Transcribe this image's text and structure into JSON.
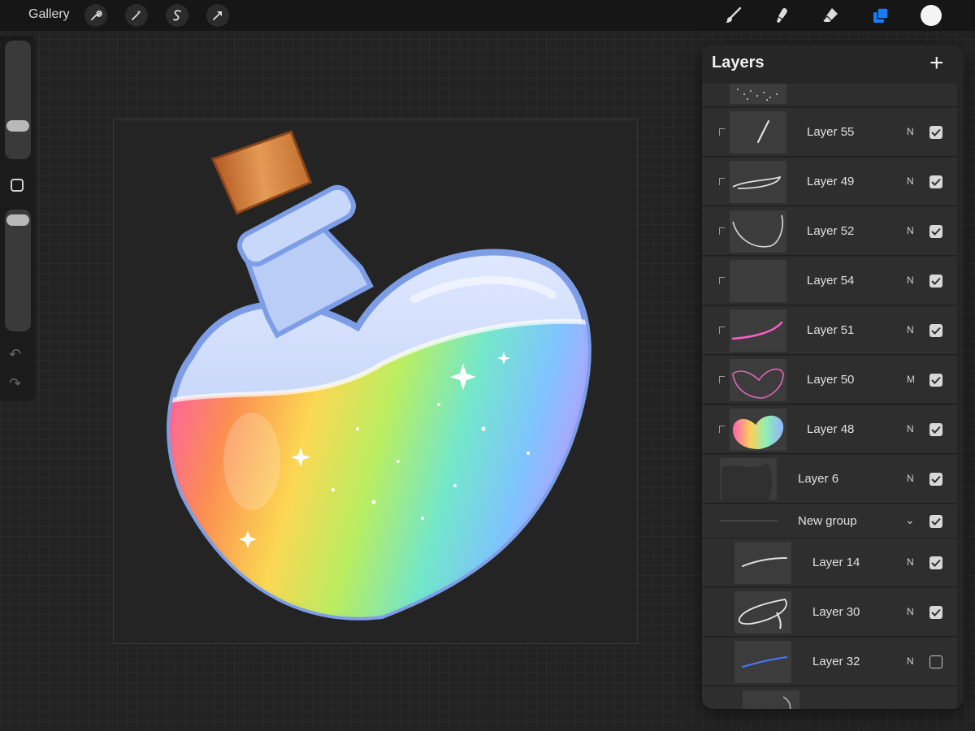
{
  "topbar": {
    "gallery_label": "Gallery",
    "left_tools": [
      {
        "icon": "wrench-icon"
      },
      {
        "icon": "magic-wand-icon"
      },
      {
        "icon": "selection-s-icon"
      },
      {
        "icon": "transform-arrow-icon"
      }
    ],
    "right_tools": [
      {
        "icon": "brush-icon"
      },
      {
        "icon": "smudge-icon"
      },
      {
        "icon": "eraser-icon"
      },
      {
        "icon": "layers-icon",
        "active": true
      }
    ],
    "current_color": "#f4f4f4",
    "accent_color": "#1a7cf5"
  },
  "layers_panel": {
    "title": "Layers",
    "add_icon": "plus-icon",
    "layers": [
      {
        "name": "Layer 55",
        "blend": "N",
        "visible": true,
        "clipped": true,
        "thumb": "stroke-white"
      },
      {
        "name": "Layer 49",
        "blend": "N",
        "visible": true,
        "clipped": true,
        "thumb": "swoosh-white"
      },
      {
        "name": "Layer 52",
        "blend": "N",
        "visible": true,
        "clipped": true,
        "thumb": "curve-white"
      },
      {
        "name": "Layer 54",
        "blend": "N",
        "visible": true,
        "clipped": true,
        "thumb": "blank"
      },
      {
        "name": "Layer 51",
        "blend": "N",
        "visible": true,
        "clipped": true,
        "thumb": "stroke-pink"
      },
      {
        "name": "Layer 50",
        "blend": "M",
        "visible": true,
        "clipped": true,
        "thumb": "outline-pink"
      },
      {
        "name": "Layer 48",
        "blend": "N",
        "visible": true,
        "clipped": true,
        "thumb": "rainbow-heart"
      },
      {
        "name": "Layer 6",
        "blend": "N",
        "visible": true,
        "clipped": false,
        "thumb": "dark-shape"
      }
    ],
    "group": {
      "name": "New group",
      "visible": true,
      "expand_icon": "chevron-down-icon"
    },
    "group_layers": [
      {
        "name": "Layer 14",
        "blend": "N",
        "visible": true,
        "thumb": "stroke-white"
      },
      {
        "name": "Layer 30",
        "blend": "N",
        "visible": true,
        "thumb": "ring-white"
      },
      {
        "name": "Layer 32",
        "blend": "N",
        "visible": false,
        "thumb": "stroke-blue"
      }
    ]
  }
}
